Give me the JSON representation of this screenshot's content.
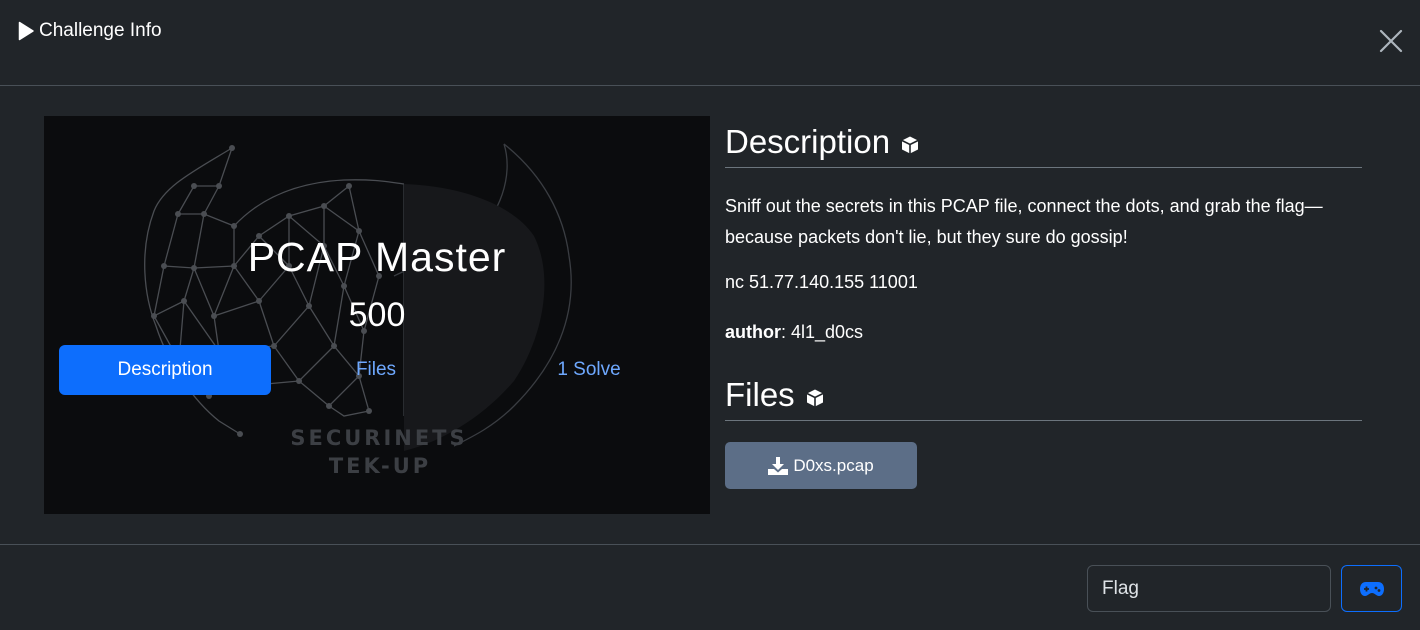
{
  "header": {
    "title": "Challenge Info",
    "close_icon": "close-icon",
    "title_icon": "play-icon"
  },
  "challenge": {
    "name": "PCAP Master",
    "value": "500",
    "logo_line1": "SECURINETS",
    "logo_line2": "TEK-UP"
  },
  "tabs": {
    "description": "Description",
    "files": "Files",
    "solves": "1 Solve"
  },
  "description": {
    "heading": "Description",
    "text": "Sniff out the secrets in this PCAP file, connect the dots, and grab the flag—because packets don't lie, but they sure do gossip!",
    "connection": "nc 51.77.140.155 11001",
    "author_label": "author",
    "author_value": ": 4l1_d0cs"
  },
  "files": {
    "heading": "Files",
    "items": [
      {
        "name": "D0xs.pcap",
        "icon": "download-icon"
      }
    ]
  },
  "footer": {
    "flag_placeholder": "Flag",
    "submit_icon": "gamepad-icon"
  },
  "colors": {
    "background": "#212529",
    "primary": "#0d6efd",
    "link": "#6ea8fe",
    "file_button": "#5c6e87"
  }
}
